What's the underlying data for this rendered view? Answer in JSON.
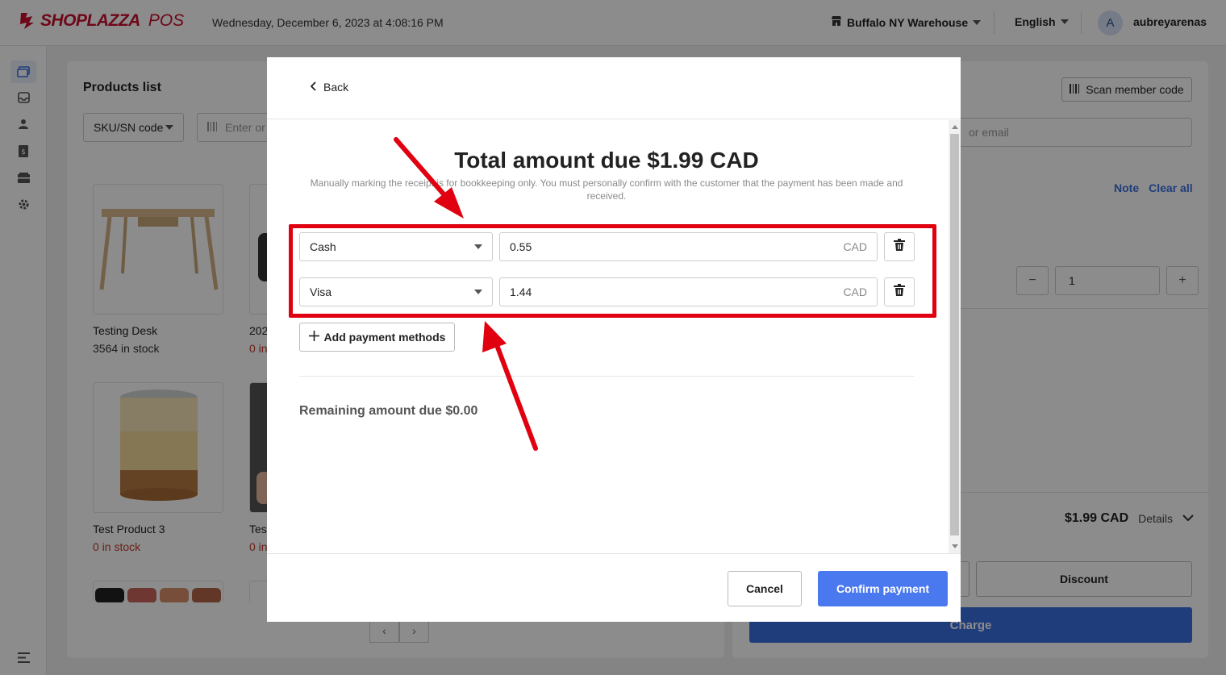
{
  "app": {
    "logo_text": "SHOPLAZZA",
    "logo_suffix": "POS",
    "datetime": "Wednesday, December 6, 2023 at 4:08:16 PM",
    "store": "Buffalo NY Warehouse",
    "language": "English",
    "avatar_initial": "A",
    "username": "aubreyarenas"
  },
  "products": {
    "title": "Products list",
    "filter_label": "SKU/SN code",
    "search_placeholder": "Enter or",
    "items": [
      {
        "name": "Testing Desk",
        "stock": "3564 in stock"
      },
      {
        "name": "202",
        "stock": "0 in"
      },
      {
        "name": "Test Product 3",
        "stock": "0 in stock"
      },
      {
        "name": "Test",
        "stock": "0 in"
      }
    ],
    "pager_prev": "‹",
    "pager_next": "›"
  },
  "cart": {
    "scan_label": "Scan member code",
    "member_placeholder": "or email",
    "note_label": "Note",
    "clear_label": "Clear all",
    "qty_minus": "−",
    "qty_value": "1",
    "qty_plus": "+",
    "total": "$1.99 CAD",
    "details_label": "Details",
    "discount_label": "Discount",
    "charge_label": "Charge"
  },
  "modal": {
    "back_label": "Back",
    "title": "Total amount due $1.99 CAD",
    "note": "Manually marking the receipt is for bookkeeping only. You must personally confirm with the customer that the payment has been made and received.",
    "payments": [
      {
        "method": "Cash",
        "amount": "0.55",
        "currency": "CAD"
      },
      {
        "method": "Visa",
        "amount": "1.44",
        "currency": "CAD"
      }
    ],
    "add_label": "Add payment methods",
    "remaining": "Remaining amount due $0.00",
    "cancel_label": "Cancel",
    "confirm_label": "Confirm payment"
  },
  "colors": {
    "primary": "#4a78ef",
    "annotation": "#e0000f",
    "brand": "#c8102e"
  }
}
